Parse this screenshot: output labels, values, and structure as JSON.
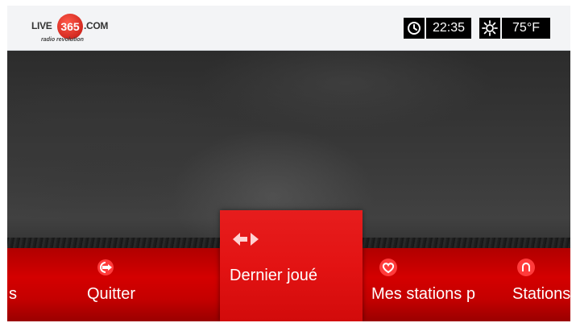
{
  "header": {
    "logo": {
      "live": "LIVE",
      "number": "365",
      "suffix": ".COM",
      "tagline": "radio revolution"
    },
    "clock": {
      "icon": "clock-icon",
      "time": "22:35"
    },
    "weather": {
      "icon": "sun-icon",
      "temperature": "75°F"
    }
  },
  "menu": {
    "items": [
      {
        "label": "s",
        "icon": null
      },
      {
        "label": "Quitter",
        "icon": "exit-icon"
      },
      {
        "label": "Dernier joué",
        "icon": "back-forward-icon",
        "selected": true
      },
      {
        "label": "Mes stations p",
        "icon": "heart-icon"
      },
      {
        "label": "Stations",
        "icon": "station-icon"
      }
    ]
  },
  "colors": {
    "accent": "#d40000",
    "selected": "#e31313",
    "header_bg": "#f3f4f6"
  }
}
